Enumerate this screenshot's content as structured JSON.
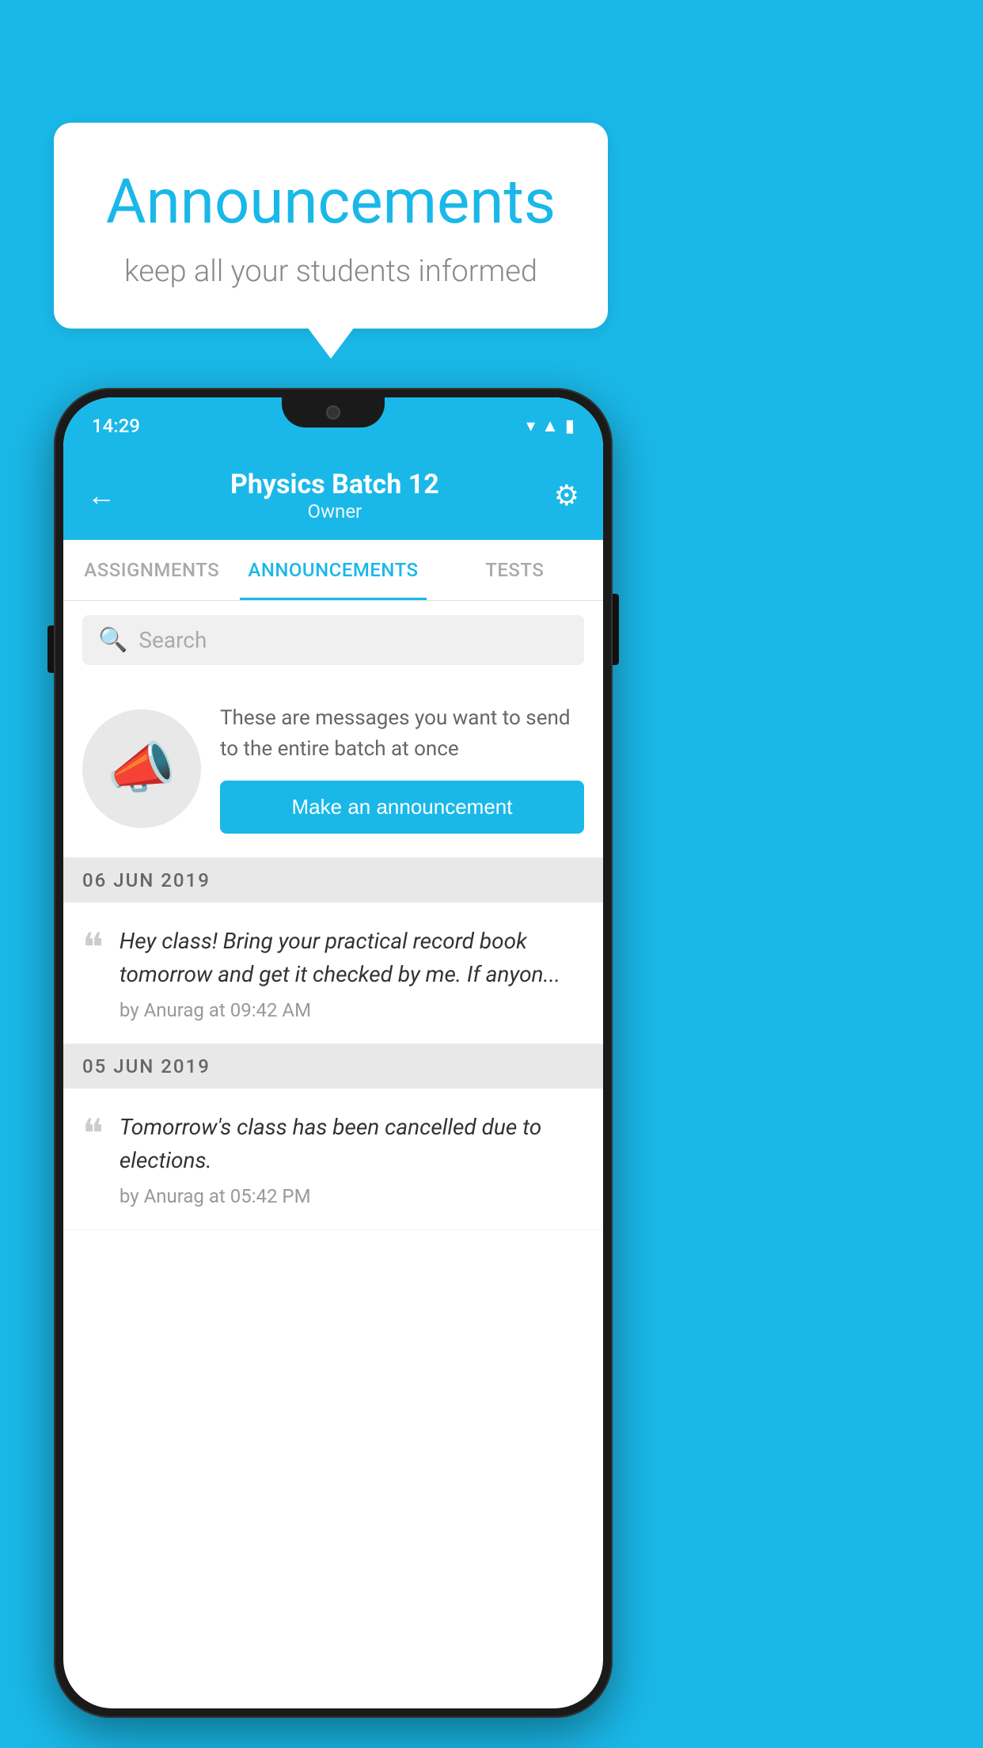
{
  "page": {
    "background_color": "#1ab8e8"
  },
  "speech_bubble": {
    "title": "Announcements",
    "subtitle": "keep all your students informed"
  },
  "phone": {
    "status_bar": {
      "time": "14:29",
      "icons": [
        "wifi",
        "signal",
        "battery"
      ]
    },
    "header": {
      "title": "Physics Batch 12",
      "subtitle": "Owner",
      "back_label": "←",
      "settings_label": "⚙"
    },
    "tabs": [
      {
        "label": "ASSIGNMENTS",
        "active": false
      },
      {
        "label": "ANNOUNCEMENTS",
        "active": true
      },
      {
        "label": "TESTS",
        "active": false
      }
    ],
    "search": {
      "placeholder": "Search"
    },
    "promo": {
      "description": "These are messages you want to send to the entire batch at once",
      "button_label": "Make an announcement"
    },
    "announcement_groups": [
      {
        "date": "06  JUN  2019",
        "items": [
          {
            "text": "Hey class! Bring your practical record book tomorrow and get it checked by me. If anyon...",
            "meta": "by Anurag at 09:42 AM"
          }
        ]
      },
      {
        "date": "05  JUN  2019",
        "items": [
          {
            "text": "Tomorrow's class has been cancelled due to elections.",
            "meta": "by Anurag at 05:42 PM"
          }
        ]
      }
    ]
  }
}
